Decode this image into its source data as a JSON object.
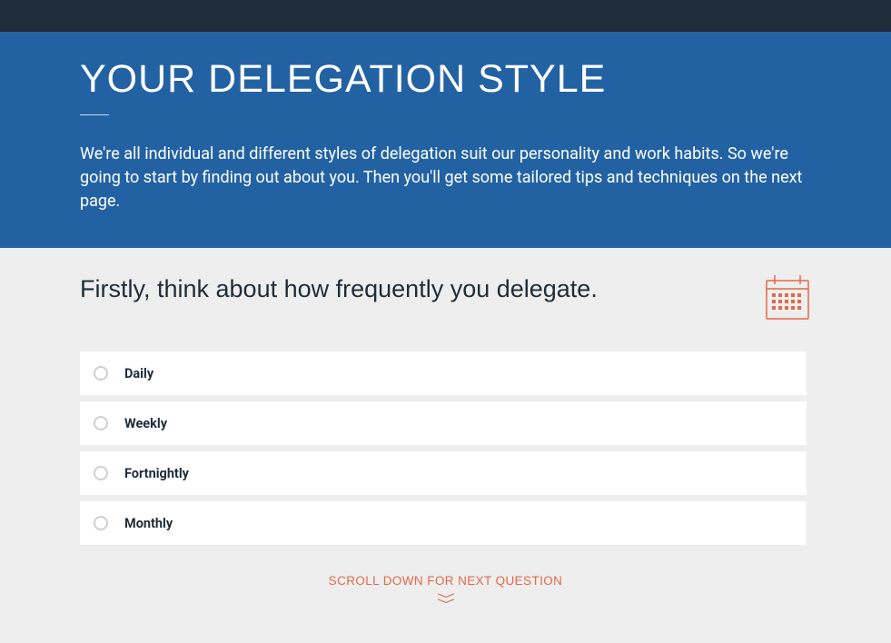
{
  "colors": {
    "accent": "#e06a49",
    "brand": "#2262a3",
    "topbar": "#1f2d3a"
  },
  "hero": {
    "title": "YOUR DELEGATION STYLE",
    "description": "We're all individual and different styles of delegation suit our personality and work habits. So we're going to start by finding out about you. Then you'll get some tailored tips and techniques on the next page."
  },
  "question": {
    "prompt": "Firstly, think about how frequently you delegate.",
    "icon": "calendar-icon",
    "options": [
      {
        "label": "Daily"
      },
      {
        "label": "Weekly"
      },
      {
        "label": "Fortnightly"
      },
      {
        "label": "Monthly"
      }
    ]
  },
  "scroll_hint": "SCROLL DOWN FOR NEXT QUESTION"
}
